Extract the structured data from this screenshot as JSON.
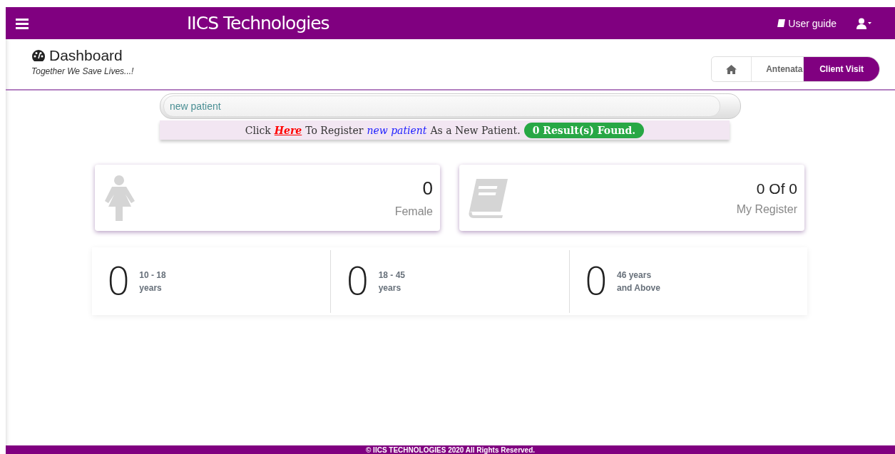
{
  "header": {
    "title": "IICS Technologies",
    "user_guide": "User guide"
  },
  "page": {
    "title": "Dashboard",
    "subtitle": "Together We Save Lives...!"
  },
  "breadcrumb": [
    {
      "kind": "home",
      "selected": false
    },
    {
      "kind": "text",
      "label": "Antenata",
      "selected": false
    },
    {
      "kind": "text",
      "label": "Client Visit",
      "selected": true
    }
  ],
  "search": {
    "value": "new patient"
  },
  "hint": {
    "before": "Click",
    "link": "Here",
    "middle": "To Register",
    "query": "new patient",
    "after": "As a New Patient.",
    "badge": "0 Result(s) Found."
  },
  "cards": [
    {
      "kind": "female",
      "value": "0",
      "label": "Female"
    },
    {
      "kind": "register",
      "value": "0 Of 0",
      "label": "My Register"
    }
  ],
  "age_groups": [
    {
      "value": "0",
      "line1": "10 - 18",
      "line2": "years"
    },
    {
      "value": "0",
      "line1": "18 - 45",
      "line2": "years"
    },
    {
      "value": "0",
      "line1": "46 years",
      "line2": "and Above"
    }
  ],
  "footer": "© IICS TECHNOLOGIES 2020 All Rights Reserved."
}
